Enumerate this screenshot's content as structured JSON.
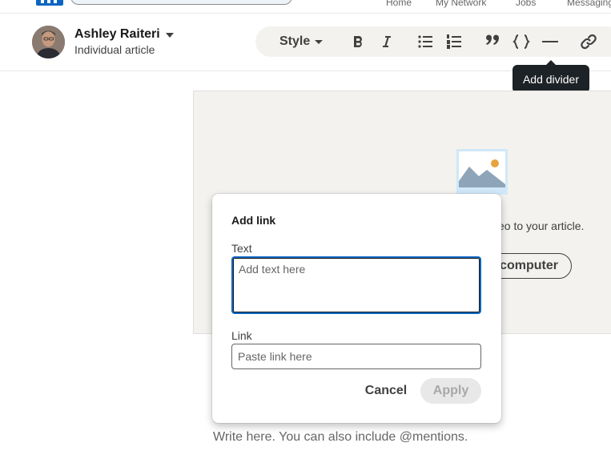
{
  "topnav": {
    "links": [
      "Home",
      "My Network",
      "Jobs",
      "Messaging"
    ]
  },
  "author": {
    "name": "Ashley Raiteri",
    "subtitle": "Individual article"
  },
  "toolbar": {
    "style_label": "Style",
    "buttons": [
      "bold-icon",
      "italic-icon",
      "bulleted-list-icon",
      "numbered-list-icon",
      "quote-icon",
      "code-block-icon",
      "divider-icon",
      "link-icon"
    ]
  },
  "tooltip": {
    "text": "Add divider"
  },
  "cover": {
    "text": "eo to your article.",
    "upload_label": "computer"
  },
  "modal": {
    "title": "Add link",
    "text_label": "Text",
    "text_placeholder": "Add text here",
    "text_value": "",
    "link_label": "Link",
    "link_placeholder": "Paste link here",
    "link_value": "",
    "cancel_label": "Cancel",
    "apply_label": "Apply"
  },
  "editor": {
    "body_placeholder": "Write here. You can also include @mentions."
  },
  "colors": {
    "brand": "#0a66c2",
    "tooltip_bg": "#1d2226",
    "cover_bg": "#f3f2ef",
    "apply_disabled_bg": "#e8e8e8"
  }
}
